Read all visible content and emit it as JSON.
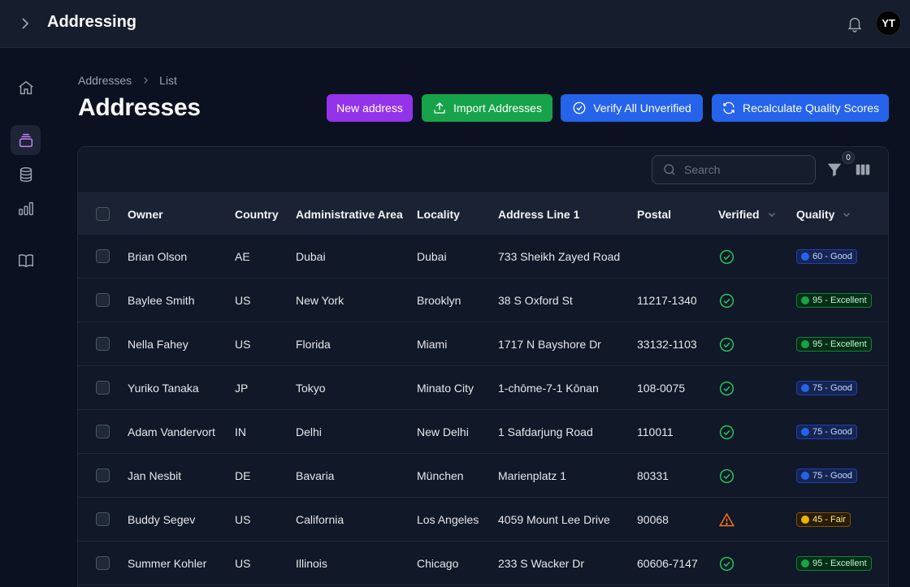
{
  "app": {
    "title": "Addressing",
    "user_initials": "YT"
  },
  "breadcrumb": {
    "root": "Addresses",
    "current": "List"
  },
  "page": {
    "title": "Addresses"
  },
  "actions": {
    "new": "New address",
    "import": "Import Addresses",
    "verify": "Verify All Unverified",
    "recalc": "Recalculate Quality Scores"
  },
  "search": {
    "placeholder": "Search"
  },
  "filter": {
    "count": "0"
  },
  "columns": {
    "owner": "Owner",
    "country": "Country",
    "admin": "Administrative Area",
    "locality": "Locality",
    "address": "Address Line 1",
    "postal": "Postal",
    "verified": "Verified",
    "quality": "Quality"
  },
  "colors": {
    "good": "#2563eb",
    "excellent": "#16a34a",
    "fair": "#eab308",
    "verified_ok": "#22c55e",
    "warning": "#f97316"
  },
  "rows": [
    {
      "owner": "Brian Olson",
      "country": "AE",
      "admin": "Dubai",
      "locality": "Dubai",
      "address": "733 Sheikh Zayed Road",
      "postal": "",
      "verified": "check-circle-icon",
      "quality": "60 - Good",
      "level": "good"
    },
    {
      "owner": "Baylee Smith",
      "country": "US",
      "admin": "New York",
      "locality": "Brooklyn",
      "address": "38 S Oxford St",
      "postal": "11217-1340",
      "verified": "check-circle-icon",
      "quality": "95 - Excellent",
      "level": "excellent"
    },
    {
      "owner": "Nella Fahey",
      "country": "US",
      "admin": "Florida",
      "locality": "Miami",
      "address": "1717 N Bayshore Dr",
      "postal": "33132-1103",
      "verified": "check-circle-icon",
      "quality": "95 - Excellent",
      "level": "excellent"
    },
    {
      "owner": "Yuriko Tanaka",
      "country": "JP",
      "admin": "Tokyo",
      "locality": "Minato City",
      "address": "1-chōme-7-1 Kōnan",
      "postal": "108-0075",
      "verified": "check-circle-icon",
      "quality": "75 - Good",
      "level": "good"
    },
    {
      "owner": "Adam Vandervort",
      "country": "IN",
      "admin": "Delhi",
      "locality": "New Delhi",
      "address": "1 Safdarjung Road",
      "postal": "110011",
      "verified": "check-circle-icon",
      "quality": "75 - Good",
      "level": "good"
    },
    {
      "owner": "Jan Nesbit",
      "country": "DE",
      "admin": "Bavaria",
      "locality": "München",
      "address": "Marienplatz 1",
      "postal": "80331",
      "verified": "check-circle-icon",
      "quality": "75 - Good",
      "level": "good"
    },
    {
      "owner": "Buddy Segev",
      "country": "US",
      "admin": "California",
      "locality": "Los Angeles",
      "address": "4059 Mount Lee Drive",
      "postal": "90068",
      "verified": "warning-triangle-icon",
      "quality": "45 - Fair",
      "level": "fair"
    },
    {
      "owner": "Summer Kohler",
      "country": "US",
      "admin": "Illinois",
      "locality": "Chicago",
      "address": "233 S Wacker Dr",
      "postal": "60606-7147",
      "verified": "check-circle-icon",
      "quality": "95 - Excellent",
      "level": "excellent"
    }
  ]
}
